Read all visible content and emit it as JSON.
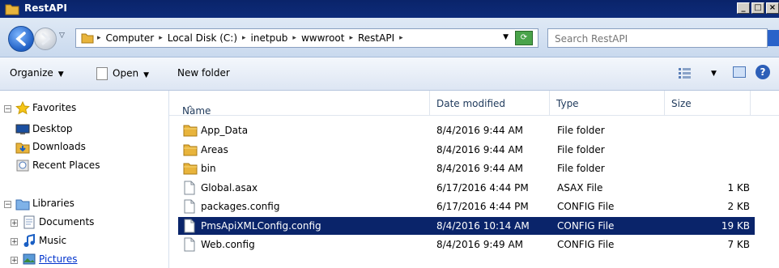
{
  "window": {
    "title": "RestAPI"
  },
  "address": {
    "crumbs": [
      "Computer",
      "Local Disk (C:)",
      "inetpub",
      "wwwroot",
      "RestAPI"
    ],
    "search_placeholder": "Search RestAPI"
  },
  "toolbar": {
    "organize": "Organize",
    "open": "Open",
    "new_folder": "New folder"
  },
  "nav": {
    "favorites": "Favorites",
    "desktop": "Desktop",
    "downloads": "Downloads",
    "recent_places": "Recent Places",
    "libraries": "Libraries",
    "documents": "Documents",
    "music": "Music",
    "pictures": "Pictures"
  },
  "columns": {
    "name": "Name",
    "date": "Date modified",
    "type": "Type",
    "size": "Size"
  },
  "files": [
    {
      "name": "App_Data",
      "date": "8/4/2016 9:44 AM",
      "type": "File folder",
      "size": "",
      "icon": "folder-icon"
    },
    {
      "name": "Areas",
      "date": "8/4/2016 9:44 AM",
      "type": "File folder",
      "size": "",
      "icon": "folder-icon"
    },
    {
      "name": "bin",
      "date": "8/4/2016 9:44 AM",
      "type": "File folder",
      "size": "",
      "icon": "folder-icon"
    },
    {
      "name": "Global.asax",
      "date": "6/17/2016 4:44 PM",
      "type": "ASAX File",
      "size": "1 KB",
      "icon": "file-icon"
    },
    {
      "name": "packages.config",
      "date": "6/17/2016 4:44 PM",
      "type": "CONFIG File",
      "size": "2 KB",
      "icon": "file-icon"
    },
    {
      "name": "PmsApiXMLConfig.config",
      "date": "8/4/2016 10:14 AM",
      "type": "CONFIG File",
      "size": "19 KB",
      "icon": "file-icon",
      "selected": true
    },
    {
      "name": "Web.config",
      "date": "8/4/2016 9:49 AM",
      "type": "CONFIG File",
      "size": "7 KB",
      "icon": "file-icon"
    }
  ],
  "colors": {
    "selection": "#0a246a",
    "title_bar": "#0a246a",
    "folder": "#e8b43c"
  }
}
